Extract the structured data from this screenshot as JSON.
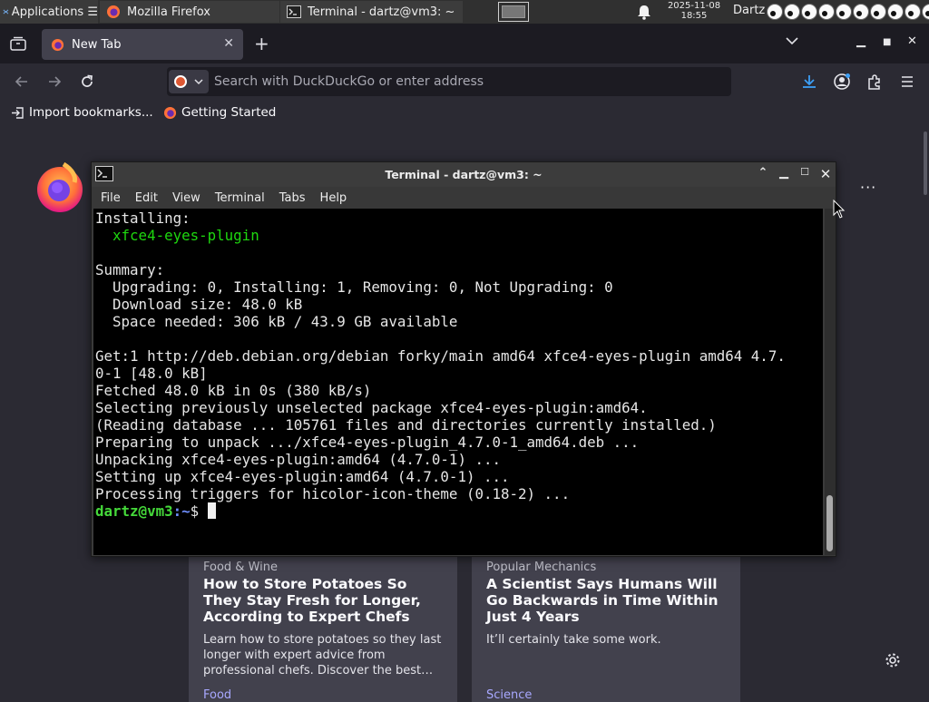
{
  "panel": {
    "applications_label": "Applications ☰",
    "tasks": [
      {
        "label": "Mozilla Firefox",
        "icon": "firefox-icon"
      },
      {
        "label": "Terminal - dartz@vm3: ~",
        "icon": "terminal-icon"
      }
    ],
    "clock_date": "2025-11-08",
    "clock_time": "18:55",
    "user": "Dartz",
    "eyes_count": 10
  },
  "browser": {
    "tab_title": "New Tab",
    "search_placeholder": "Search with DuckDuckGo or enter address",
    "bookmarks": [
      {
        "label": "Import bookmarks...",
        "icon": "import-icon"
      },
      {
        "label": "Getting Started",
        "icon": "firefox-icon"
      }
    ],
    "more_label": "···"
  },
  "terminal": {
    "title": "Terminal - dartz@vm3: ~",
    "menu": [
      "File",
      "Edit",
      "View",
      "Terminal",
      "Tabs",
      "Help"
    ],
    "lines": [
      "Installing:",
      "  xfce4-eyes-plugin",
      "",
      "Summary:",
      "  Upgrading: 0, Installing: 1, Removing: 0, Not Upgrading: 0",
      "  Download size: 48.0 kB",
      "  Space needed: 306 kB / 43.9 GB available",
      "",
      "Get:1 http://deb.debian.org/debian forky/main amd64 xfce4-eyes-plugin amd64 4.7.",
      "0-1 [48.0 kB]",
      "Fetched 48.0 kB in 0s (380 kB/s)",
      "Selecting previously unselected package xfce4-eyes-plugin:amd64.",
      "(Reading database ... 105761 files and directories currently installed.)",
      "Preparing to unpack .../xfce4-eyes-plugin_4.7.0-1_amd64.deb ...",
      "Unpacking xfce4-eyes-plugin:amd64 (4.7.0-1) ...",
      "Setting up xfce4-eyes-plugin:amd64 (4.7.0-1) ...",
      "Processing triggers for hicolor-icon-theme (0.18-2) ..."
    ],
    "prompt_user": "dartz@vm3",
    "prompt_path": ":~",
    "prompt_symbol": "$ "
  },
  "cards": [
    {
      "source": "Food & Wine",
      "title": "How to Store Potatoes So They Stay Fresh for Longer, According to Expert Chefs",
      "description": "Learn how to store potatoes so they last longer with expert advice from professional chefs. Discover the best…",
      "category": "Food"
    },
    {
      "source": "Popular Mechanics",
      "title": "A Scientist Says Humans Will Go Backwards in Time Within Just 4 Years",
      "description": "It’ll certainly take some work.",
      "category": "Science"
    }
  ]
}
